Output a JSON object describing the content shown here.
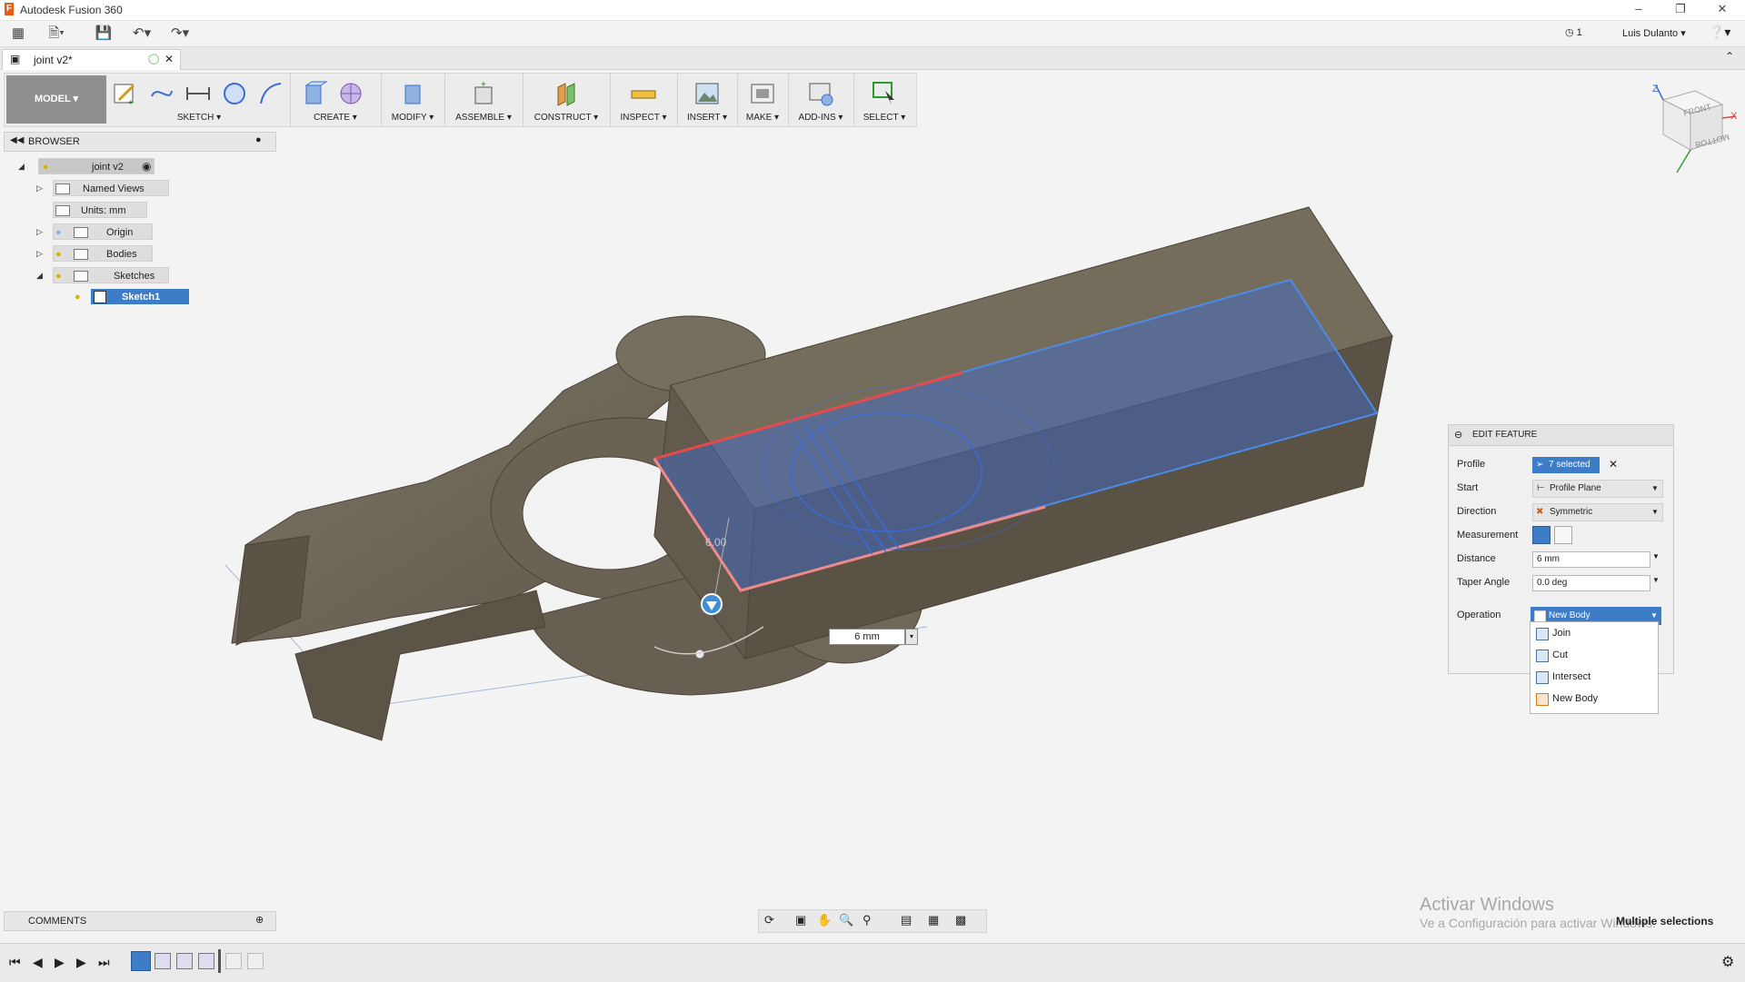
{
  "app": {
    "title": "Autodesk Fusion 360",
    "user": "Luis Dulanto",
    "jobs_count": "1"
  },
  "document": {
    "tab_title": "joint v2*"
  },
  "toolbar": {
    "workspace": "MODEL",
    "groups": [
      {
        "label": "SKETCH"
      },
      {
        "label": "CREATE"
      },
      {
        "label": "MODIFY"
      },
      {
        "label": "ASSEMBLE"
      },
      {
        "label": "CONSTRUCT"
      },
      {
        "label": "INSPECT"
      },
      {
        "label": "INSERT"
      },
      {
        "label": "MAKE"
      },
      {
        "label": "ADD-INS"
      },
      {
        "label": "SELECT"
      }
    ]
  },
  "browser": {
    "title": "BROWSER",
    "root": "joint v2",
    "items": [
      {
        "label": "Named Views"
      },
      {
        "label": "Units: mm"
      },
      {
        "label": "Origin"
      },
      {
        "label": "Bodies"
      },
      {
        "label": "Sketches"
      },
      {
        "label": "Sketch1"
      }
    ]
  },
  "comments": {
    "title": "COMMENTS"
  },
  "viewcube": {
    "front": "FRONT",
    "bottom": "BOTTOM",
    "z": "Z",
    "x": "X"
  },
  "viewport": {
    "distance_input": "6 mm",
    "angle_ghost": "6.00"
  },
  "edit_feature": {
    "title": "EDIT FEATURE",
    "profile_label": "Profile",
    "profile_value": "7 selected",
    "start_label": "Start",
    "start_value": "Profile Plane",
    "direction_label": "Direction",
    "direction_value": "Symmetric",
    "measurement_label": "Measurement",
    "distance_label": "Distance",
    "distance_value": "6 mm",
    "taper_label": "Taper Angle",
    "taper_value": "0.0 deg",
    "operation_label": "Operation",
    "operation_value": "New Body",
    "operation_options": [
      "Join",
      "Cut",
      "Intersect",
      "New Body"
    ]
  },
  "status": {
    "selection": "Multiple selections"
  },
  "watermark": {
    "line1": "Activar Windows",
    "line2": "Ve a Configuración para activar Windows."
  },
  "colors": {
    "accent": "#3d7dc8",
    "body": "#6e6556",
    "selection": "#3b6bd6",
    "profile_edge": "#e84a4a"
  }
}
